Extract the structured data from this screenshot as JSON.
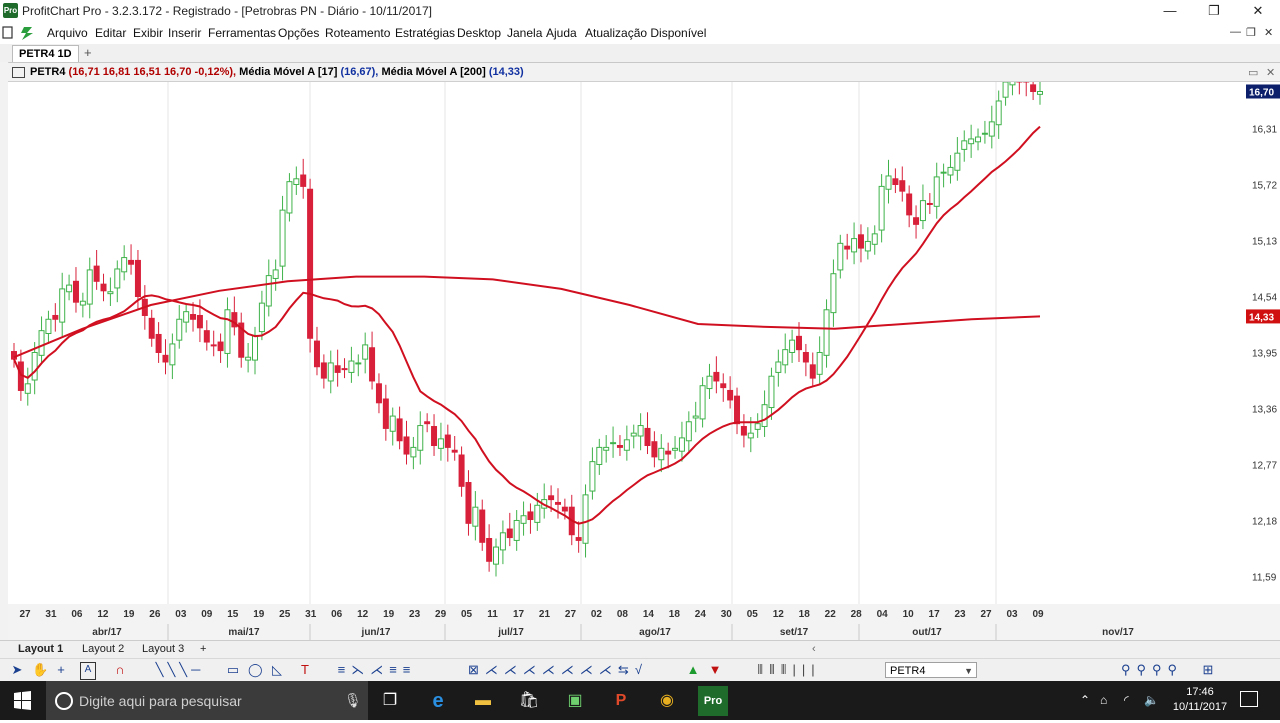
{
  "window": {
    "title": "ProfitChart Pro - 3.2.3.172 - Registrado - [Petrobras PN - Diário - 10/11/2017]",
    "app_icon_text": "Pro",
    "minimize": "—",
    "restore": "❐",
    "close": "✕"
  },
  "menu": {
    "items": [
      "Arquivo",
      "Editar",
      "Exibir",
      "Inserir",
      "Ferramentas",
      "Opções",
      "Roteamento",
      "Estratégias",
      "Desktop",
      "Janela",
      "Ajuda",
      "Atualização Disponível"
    ],
    "mdi_minimize": "—",
    "mdi_restore": "❐",
    "mdi_close": "✕"
  },
  "tabs": {
    "doc_tab": "PETR4 1D",
    "add": "+"
  },
  "chart_header": {
    "symbol": "PETR4",
    "ohlc": "(16,71  16,81  16,51  16,70  -0,12%),",
    "ma17_label": "Média Móvel A [17]",
    "ma17_value": "(16,67),",
    "ma200_label": "Média Móvel A [200]",
    "ma200_value": "(14,33)"
  },
  "chart_data": {
    "type": "candlestick",
    "symbol": "PETR4",
    "interval": "Diário",
    "ylim": [
      11.3,
      16.8
    ],
    "y_ticks": [
      "16,31",
      "15,72",
      "15,13",
      "14,54",
      "13,95",
      "13,36",
      "12,77",
      "12,18",
      "11,59"
    ],
    "price_tags": [
      {
        "label": "16,70",
        "value": 16.7,
        "color": "#0b1f6b"
      },
      {
        "label": "14,33",
        "value": 14.33,
        "color": "#d01010"
      }
    ],
    "x_labels": [
      "27",
      "31",
      "06",
      "12",
      "19",
      "26",
      "03",
      "09",
      "15",
      "19",
      "25",
      "31",
      "06",
      "12",
      "19",
      "23",
      "29",
      "05",
      "11",
      "17",
      "21",
      "27",
      "02",
      "08",
      "14",
      "18",
      "24",
      "30",
      "05",
      "12",
      "18",
      "22",
      "28",
      "04",
      "10",
      "17",
      "23",
      "27",
      "03",
      "09"
    ],
    "months": [
      "abr/17",
      "mai/17",
      "jun/17",
      "jul/17",
      "ago/17",
      "set/17",
      "out/17",
      "nov/17"
    ],
    "candle_closes": [
      13.88,
      13.55,
      13.62,
      13.95,
      14.18,
      14.3,
      14.3,
      14.62,
      14.66,
      14.48,
      14.49,
      14.82,
      14.7,
      14.6,
      14.59,
      14.83,
      14.95,
      14.88,
      14.54,
      14.34,
      14.1,
      13.95,
      13.85,
      14.04,
      14.3,
      14.38,
      14.3,
      14.21,
      14.06,
      14.02,
      13.97,
      14.4,
      14.22,
      13.9,
      13.9,
      14.13,
      14.47,
      14.76,
      14.82,
      15.45,
      15.75,
      15.78,
      15.7,
      14.1,
      13.8,
      13.68,
      13.84,
      13.74,
      13.77,
      13.86,
      13.84,
      14.03,
      13.65,
      13.42,
      13.15,
      13.28,
      13.02,
      12.88,
      12.95,
      13.18,
      13.2,
      12.97,
      13.04,
      12.95,
      12.9,
      12.54,
      12.15,
      12.32,
      11.95,
      11.75,
      11.9,
      12.05,
      12.0,
      12.18,
      12.23,
      12.19,
      12.34,
      12.4,
      12.4,
      12.35,
      12.28,
      12.03,
      11.97,
      12.45,
      12.8,
      12.95,
      12.95,
      13.0,
      12.95,
      13.03,
      13.1,
      13.18,
      12.97,
      12.85,
      12.94,
      12.88,
      12.94,
      13.05,
      13.22,
      13.28,
      13.6,
      13.7,
      13.65,
      13.58,
      13.45,
      13.2,
      13.08,
      13.1,
      13.2,
      13.4,
      13.7,
      13.85,
      13.98,
      14.08,
      13.98,
      13.85,
      13.68,
      13.95,
      14.4,
      14.78,
      15.1,
      15.04,
      15.15,
      15.05,
      15.12,
      15.2,
      15.7,
      15.81,
      15.72,
      15.65,
      15.4,
      15.3,
      15.55,
      15.52,
      15.8,
      15.85,
      15.9,
      16.05,
      16.18,
      16.2,
      16.22,
      16.26,
      16.38,
      16.6,
      16.8,
      16.85,
      16.8,
      16.8,
      16.7,
      16.7
    ],
    "series": [
      {
        "name": "Média Móvel A [17]",
        "color": "#d01020",
        "last_value": 16.67
      },
      {
        "name": "Média Móvel A [200]",
        "color": "#d01020",
        "last_value": 14.33
      }
    ],
    "grid": true
  },
  "layouts": {
    "tabs": [
      "Layout 1",
      "Layout 2",
      "Layout 3"
    ],
    "add": "+"
  },
  "toolbar": {
    "asset_value": "PETR4"
  },
  "taskbar": {
    "search_placeholder": "Digite aqui para pesquisar",
    "pro_label": "Pro",
    "time": "17:46",
    "date": "10/11/2017"
  }
}
